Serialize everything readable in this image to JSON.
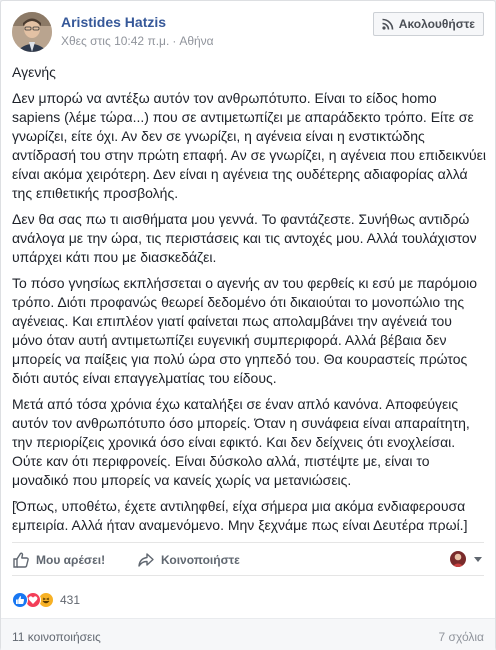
{
  "post": {
    "author": "Aristides Hatzis",
    "time": "Χθες στις 10:42 π.μ.",
    "location": "Αθήνα",
    "follow_label": "Ακολουθήστε",
    "paragraphs": [
      "Αγενής",
      "Δεν μπορώ να αντέξω αυτόν τον ανθρωπότυπο. Είναι το είδος homo sapiens (λέμε τώρα...) που σε αντιμετωπίζει με απαράδεκτο τρόπο. Είτε σε γνωρίζει, είτε όχι. Αν δεν σε γνωρίζει, η αγένεια είναι η ενστικτώδης αντίδρασή του στην πρώτη επαφή. Αν σε γνωρίζει, η αγένεια που επιδεικνύει είναι ακόμα χειρότερη. Δεν είναι η αγένεια της ουδέτερης αδιαφορίας αλλά της επιθετικής προσβολής.",
      "Δεν θα σας πω τι αισθήματα μου γεννά. Το φαντάζεστε. Συνήθως αντιδρώ ανάλογα με την ώρα, τις περιστάσεις και τις αντοχές μου. Αλλά τουλάχιστον υπάρχει κάτι που με διασκεδάζει.",
      "Το πόσο γνησίως εκπλήσσεται ο αγενής αν του φερθείς κι εσύ με παρόμοιο τρόπο. Διότι προφανώς θεωρεί δεδομένο ότι δικαιούται το μονοπώλιο της αγένειας. Και επιπλέον γιατί φαίνεται πως απολαμβάνει την αγένειά του μόνο όταν αυτή αντιμετωπίζει ευγενική συμπεριφορά. Αλλά βέβαια δεν μπορείς να παίξεις για πολύ ώρα στο γηπεδό του. Θα κουραστείς πρώτος διότι αυτός είναι επαγγελματίας του είδους.",
      "Μετά από τόσα χρόνια έχω καταλήξει σε έναν απλό κανόνα. Αποφεύγεις αυτόν τον ανθρωπότυπο όσο μπορείς. Όταν η συνάφεια είναι απαραίτητη, την περιορίζεις χρονικά όσο είναι εφικτό. Και δεν δείχνεις ότι ενοχλείσαι. Ούτε καν ότι περιφρονείς. Είναι δύσκολο αλλά, πιστέψτε με, είναι το μοναδικό που μπορείς να κανείς χωρίς να μετανιώσεις.",
      "[Όπως, υποθέτω, έχετε αντιληφθεί, είχα σήμερα μια ακόμα ενδιαφερουσα εμπειρία. Αλλά ήταν αναμενόμενο. Μην ξεχνάμε πως είναι Δευτέρα πρωί.]"
    ]
  },
  "actions": {
    "like_label": "Μου αρέσει!",
    "share_label": "Κοινοποιήστε"
  },
  "reactions": {
    "icons": [
      "like-reaction-icon",
      "love-reaction-icon",
      "haha-reaction-icon"
    ],
    "colors": {
      "like": "#1877f2",
      "love": "#f33e58",
      "haha": "#f7b125"
    },
    "count": "431"
  },
  "footer": {
    "shares": "11 κοινοποιήσεις",
    "comments": "7 σχόλια"
  }
}
